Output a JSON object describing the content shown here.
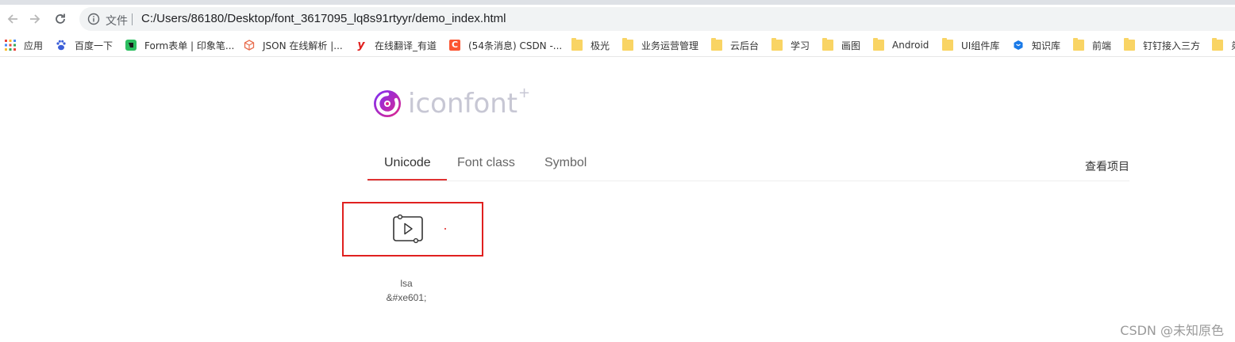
{
  "browser": {
    "scheme_label": "文件",
    "url": "C:/Users/86180/Desktop/font_3617095_lq8s91rtyyr/demo_index.html"
  },
  "bookmarks": [
    {
      "label": "应用",
      "icon": "apps-grid-icon"
    },
    {
      "label": "百度一下",
      "icon": "baidu-paw-icon"
    },
    {
      "label": "Form表单 | 印象笔...",
      "icon": "evernote-icon"
    },
    {
      "label": "JSON 在线解析 |...",
      "icon": "json-cube-icon"
    },
    {
      "label": "在线翻译_有道",
      "icon": "youdao-icon"
    },
    {
      "label": "(54条消息) CSDN -...",
      "icon": "csdn-icon"
    },
    {
      "label": "极光",
      "icon": "folder-icon"
    },
    {
      "label": "业务运营管理",
      "icon": "folder-icon"
    },
    {
      "label": "云后台",
      "icon": "folder-icon"
    },
    {
      "label": "学习",
      "icon": "folder-icon"
    },
    {
      "label": "画图",
      "icon": "folder-icon"
    },
    {
      "label": "Android",
      "icon": "folder-icon"
    },
    {
      "label": "UI组件库",
      "icon": "folder-icon"
    },
    {
      "label": "知识库",
      "icon": "knowledge-base-icon"
    },
    {
      "label": "前端",
      "icon": "folder-icon"
    },
    {
      "label": "钉钉接入三方",
      "icon": "folder-icon"
    },
    {
      "label": "弟",
      "icon": "folder-icon"
    }
  ],
  "logo": {
    "text": "iconfont",
    "plus": "+"
  },
  "tabs": [
    {
      "label": "Unicode",
      "active": true
    },
    {
      "label": "Font class",
      "active": false
    },
    {
      "label": "Symbol",
      "active": false
    }
  ],
  "view_project_label": "查看项目",
  "icon_item": {
    "name": "lsa",
    "code": "&#xe601;",
    "glyph": "play-frame-icon"
  },
  "watermark": "CSDN @未知原色",
  "colors": {
    "accent_red": "#e0201f",
    "logo_gray": "#c7c7d4",
    "logo_gradient_start": "#7b2ff7",
    "logo_gradient_end": "#e0268a"
  }
}
